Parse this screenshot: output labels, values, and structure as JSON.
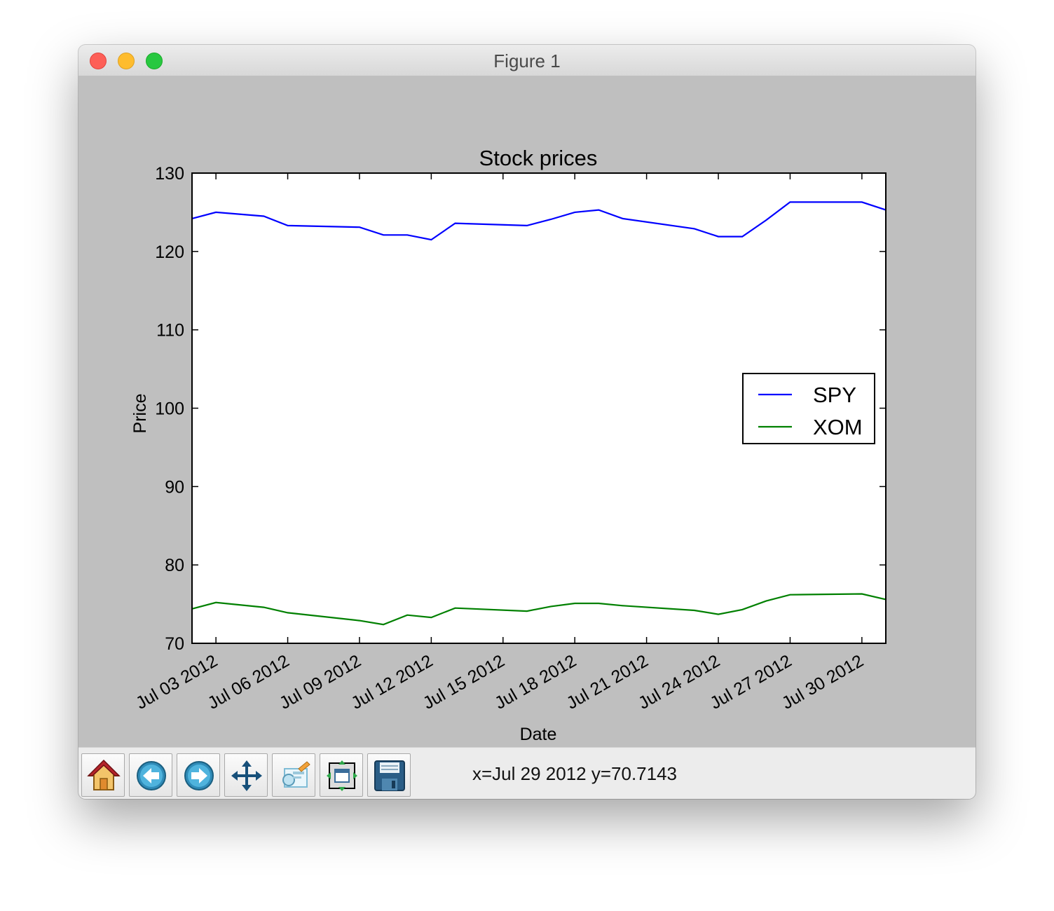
{
  "window": {
    "title": "Figure 1"
  },
  "toolbar": {
    "buttons": [
      {
        "name": "home-button",
        "icon": "home-icon"
      },
      {
        "name": "back-button",
        "icon": "back-arrow-icon"
      },
      {
        "name": "forward-button",
        "icon": "forward-arrow-icon"
      },
      {
        "name": "pan-button",
        "icon": "pan-move-icon"
      },
      {
        "name": "zoom-button",
        "icon": "zoom-rect-icon"
      },
      {
        "name": "subplots-button",
        "icon": "subplots-config-icon"
      },
      {
        "name": "save-button",
        "icon": "save-floppy-icon"
      }
    ],
    "coords": "x=Jul 29 2012 y=70.7143"
  },
  "chart_data": {
    "type": "line",
    "title": "Stock prices",
    "xlabel": "Date",
    "ylabel": "Price",
    "ylim": [
      70,
      130
    ],
    "xlim": [
      "2012-07-02",
      "2012-07-31"
    ],
    "yticks": [
      "70",
      "80",
      "90",
      "100",
      "110",
      "120",
      "130"
    ],
    "xticks": [
      "Jul 03 2012",
      "Jul 06 2012",
      "Jul 09 2012",
      "Jul 12 2012",
      "Jul 15 2012",
      "Jul 18 2012",
      "Jul 21 2012",
      "Jul 24 2012",
      "Jul 27 2012",
      "Jul 30 2012"
    ],
    "xtick_dates": [
      "2012-07-03",
      "2012-07-06",
      "2012-07-09",
      "2012-07-12",
      "2012-07-15",
      "2012-07-18",
      "2012-07-21",
      "2012-07-24",
      "2012-07-27",
      "2012-07-30"
    ],
    "x": [
      "2012-07-02",
      "2012-07-03",
      "2012-07-05",
      "2012-07-06",
      "2012-07-09",
      "2012-07-10",
      "2012-07-11",
      "2012-07-12",
      "2012-07-13",
      "2012-07-16",
      "2012-07-17",
      "2012-07-18",
      "2012-07-19",
      "2012-07-20",
      "2012-07-23",
      "2012-07-24",
      "2012-07-25",
      "2012-07-26",
      "2012-07-27",
      "2012-07-30",
      "2012-07-31"
    ],
    "series": [
      {
        "name": "SPY",
        "color": "#0000ff",
        "values": [
          124.2,
          125.0,
          124.5,
          123.3,
          123.1,
          122.1,
          122.1,
          121.5,
          123.6,
          123.3,
          124.1,
          125.0,
          125.3,
          124.2,
          122.9,
          121.9,
          121.9,
          124.0,
          126.3,
          126.3,
          125.3
        ]
      },
      {
        "name": "XOM",
        "color": "#008000",
        "values": [
          74.4,
          75.2,
          74.6,
          73.9,
          72.9,
          72.4,
          73.6,
          73.3,
          74.5,
          74.1,
          74.7,
          75.1,
          75.1,
          74.8,
          74.2,
          73.7,
          74.3,
          75.4,
          76.2,
          76.3,
          75.6
        ]
      }
    ],
    "legend": {
      "placement": "center-right",
      "entries": [
        "SPY",
        "XOM"
      ]
    },
    "grid": false
  }
}
